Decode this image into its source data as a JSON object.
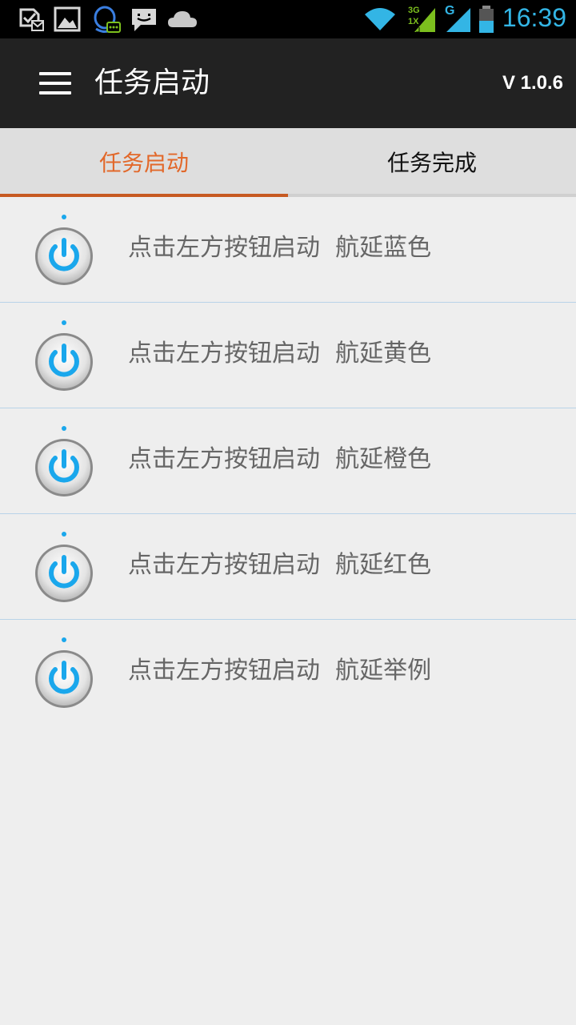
{
  "status_bar": {
    "time": "16:39",
    "network_3g": "3G",
    "network_1x": "1X",
    "network_g": "G",
    "icons": [
      "messaging-check-icon",
      "gallery-icon",
      "qq-icon",
      "sms-icon",
      "cloud-icon",
      "wifi-icon",
      "signal-3g-icon",
      "signal-g-icon",
      "battery-icon"
    ]
  },
  "app_bar": {
    "title": "任务启动",
    "version": "V 1.0.6"
  },
  "tabs": [
    {
      "label": "任务启动",
      "active": true
    },
    {
      "label": "任务完成",
      "active": false
    }
  ],
  "tasks": [
    {
      "label": "点击左方按钮启动  航延蓝色",
      "icon": "power-icon"
    },
    {
      "label": "点击左方按钮启动  航延黄色",
      "icon": "power-icon"
    },
    {
      "label": "点击左方按钮启动  航延橙色",
      "icon": "power-icon"
    },
    {
      "label": "点击左方按钮启动  航延红色",
      "icon": "power-icon"
    },
    {
      "label": "点击左方按钮启动  航延举例",
      "icon": "power-icon"
    }
  ],
  "colors": {
    "accent": "#e2682a",
    "indicator": "#c75a22",
    "status_blue": "#33b5e5",
    "power_blue": "#1aa7ec",
    "app_bar": "#222222"
  }
}
